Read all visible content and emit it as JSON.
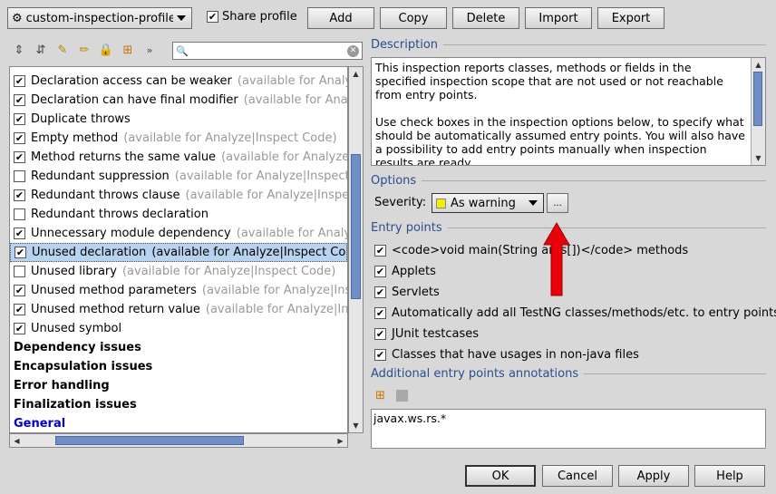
{
  "toolbar": {
    "profile": "custom-inspection-profile",
    "share_profile": "Share profile",
    "share_checked": true,
    "buttons": {
      "add": "Add",
      "copy": "Copy",
      "delete": "Delete",
      "import": "Import",
      "export": "Export"
    }
  },
  "search": {
    "value": ""
  },
  "tree": {
    "items": [
      {
        "name": "Declaration access can be weaker",
        "avail": "(available for Analyze|Inspect Code)",
        "checked": true
      },
      {
        "name": "Declaration can have final modifier",
        "avail": "(available for Analyze|Inspect Code)",
        "checked": true
      },
      {
        "name": "Duplicate throws",
        "avail": "",
        "checked": true
      },
      {
        "name": "Empty method",
        "avail": "(available for Analyze|Inspect Code)",
        "checked": true
      },
      {
        "name": "Method returns the same value",
        "avail": "(available for Analyze|Inspect Code)",
        "checked": true
      },
      {
        "name": "Redundant suppression",
        "avail": "(available for Analyze|Inspect Code)",
        "checked": false
      },
      {
        "name": "Redundant throws clause",
        "avail": "(available for Analyze|Inspect Code)",
        "checked": true
      },
      {
        "name": "Redundant throws declaration",
        "avail": "",
        "checked": false
      },
      {
        "name": "Unnecessary module dependency",
        "avail": "(available for Analyze|Inspect Code)",
        "checked": true
      },
      {
        "name": "Unused declaration",
        "avail": "(available for Analyze|Inspect Code)",
        "checked": true,
        "selected": true
      },
      {
        "name": "Unused library",
        "avail": "(available for Analyze|Inspect Code)",
        "checked": false
      },
      {
        "name": "Unused method parameters",
        "avail": "(available for Analyze|Inspect Code)",
        "checked": true
      },
      {
        "name": "Unused method return value",
        "avail": "(available for Analyze|Inspect Code)",
        "checked": true
      },
      {
        "name": "Unused symbol",
        "avail": "",
        "checked": true
      }
    ],
    "groups": [
      "Dependency issues",
      "Encapsulation issues",
      "Error handling",
      "Finalization issues",
      "General"
    ]
  },
  "description": {
    "title": "Description",
    "p1": "This inspection reports classes, methods or fields in the specified inspection scope that are not used or not reachable from entry points.",
    "p2": "Use check boxes in the inspection options below, to specify what should be automatically assumed entry points. You will also have a possibility to add entry points manually when inspection results are ready."
  },
  "options": {
    "title": "Options",
    "severity_label": "Severity:",
    "severity_value": "As warning",
    "ellipsis": "...",
    "severity_color": "#f0f000"
  },
  "entry_points": {
    "title": "Entry points",
    "items": [
      {
        "label": "<code>void main(String args[])</code> methods",
        "checked": true
      },
      {
        "label": "Applets",
        "checked": true
      },
      {
        "label": "Servlets",
        "checked": true
      },
      {
        "label": "Automatically add all TestNG classes/methods/etc. to entry points",
        "checked": true
      },
      {
        "label": "JUnit testcases",
        "checked": true
      },
      {
        "label": "Classes that have usages in non-java files",
        "checked": true
      }
    ]
  },
  "annotations": {
    "title": "Additional entry points annotations",
    "values": [
      "javax.ws.rs.*"
    ]
  },
  "footer": {
    "ok": "OK",
    "cancel": "Cancel",
    "apply": "Apply",
    "help": "Help"
  },
  "colors": {
    "accent": "#2a4e8e",
    "arrow": "#e8000a",
    "selection": "#b8d3f0"
  }
}
